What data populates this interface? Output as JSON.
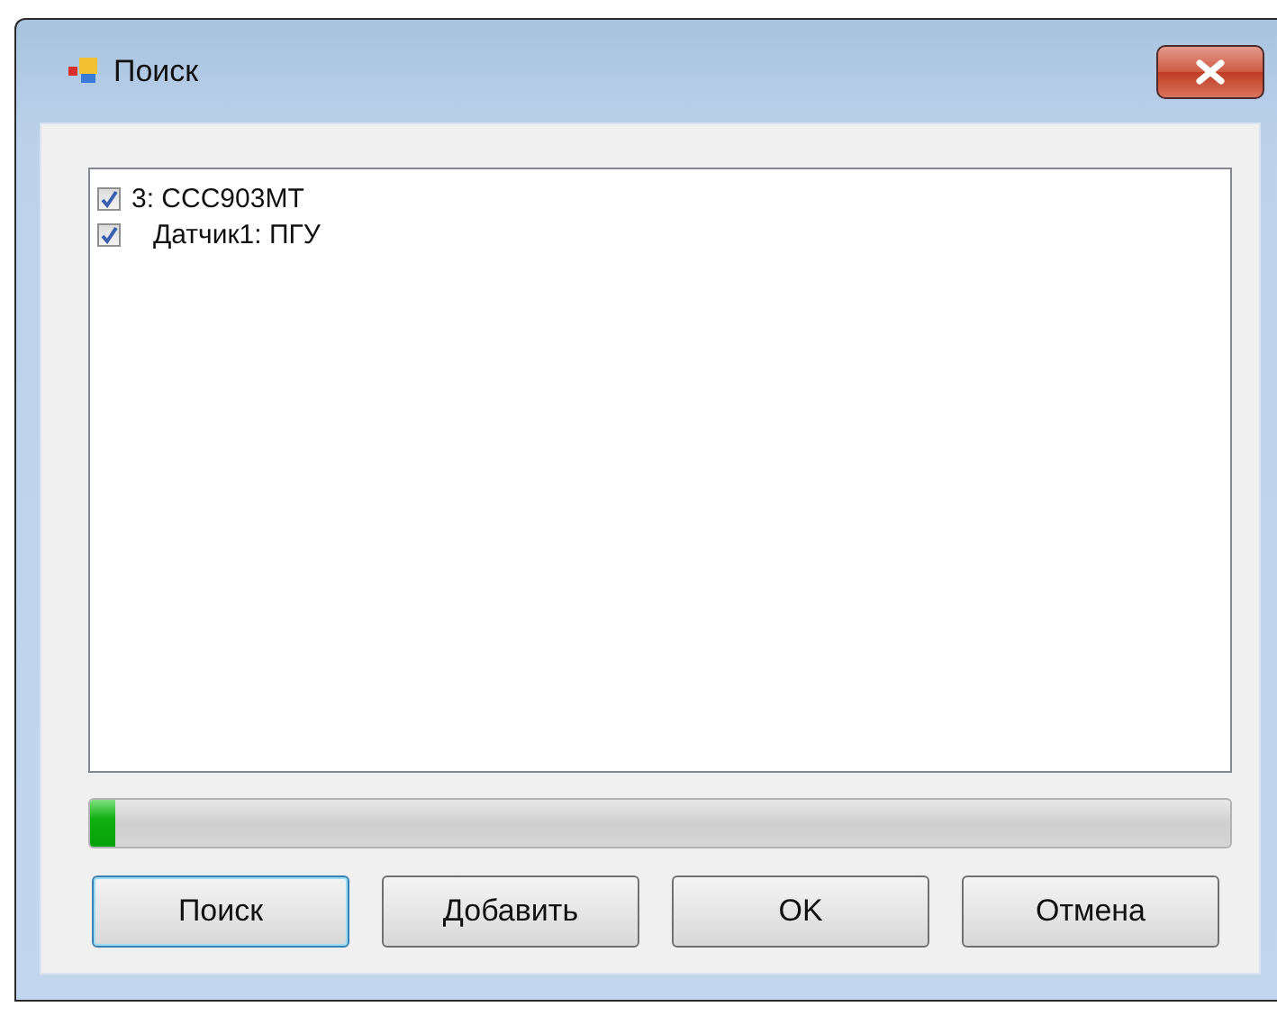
{
  "window": {
    "title": "Поиск"
  },
  "tree": {
    "items": [
      {
        "label": "3: CCC903MT",
        "checked": true,
        "children": [
          {
            "label": "Датчик1: ПГУ",
            "checked": true
          }
        ]
      }
    ]
  },
  "progress": {
    "level": 0.022
  },
  "buttons": [
    {
      "label": "Поиск",
      "focused": true
    },
    {
      "label": "Добавить",
      "focused": false
    },
    {
      "label": "OK",
      "focused": false
    },
    {
      "label": "Отмена",
      "focused": false
    }
  ]
}
